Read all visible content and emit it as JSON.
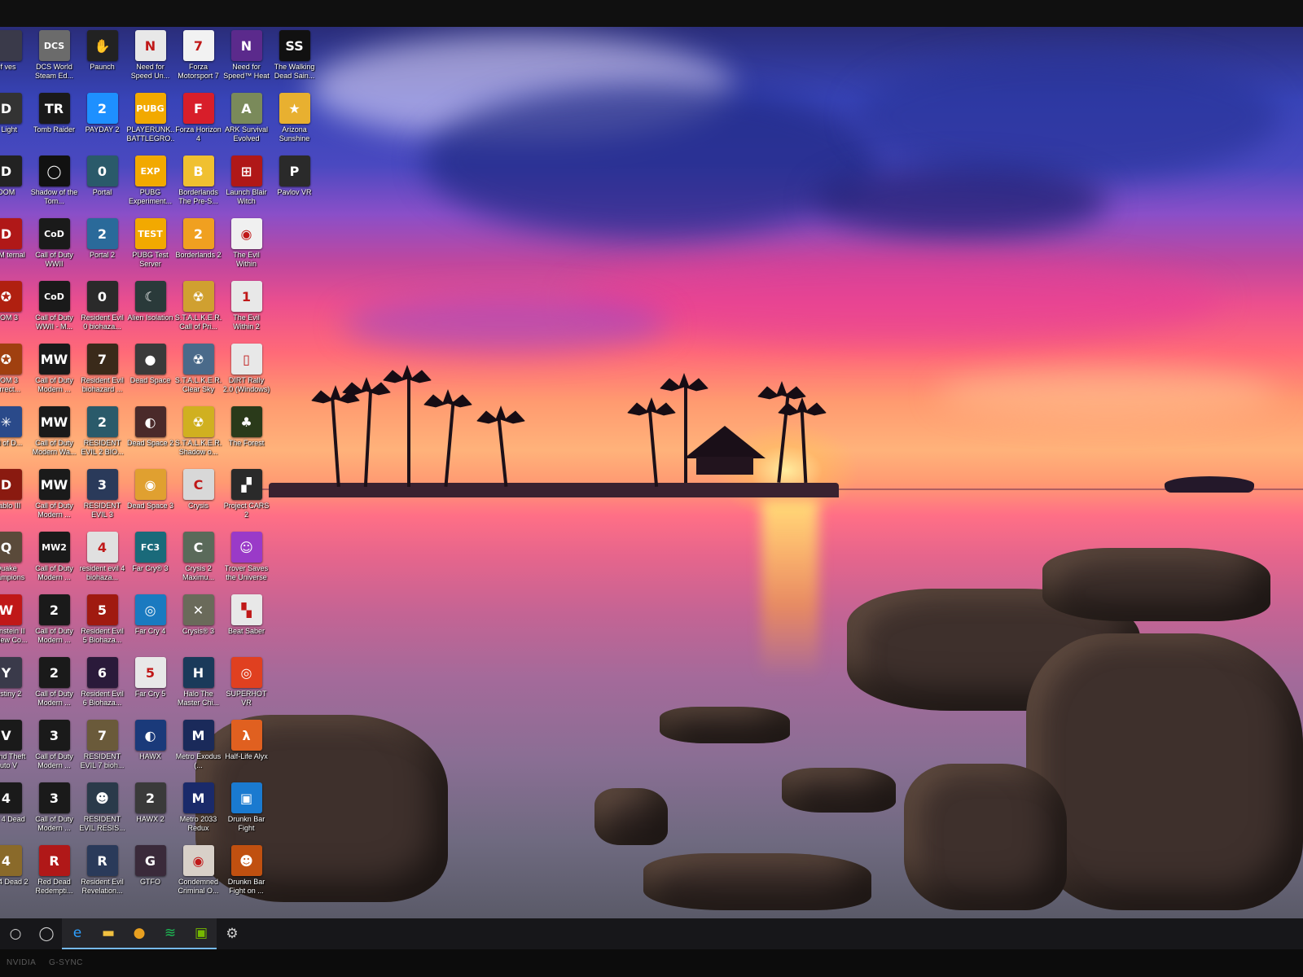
{
  "desktop": {
    "icons": [
      {
        "label": "of ves",
        "color": "#3a3a4a",
        "glyph": ""
      },
      {
        "label": "DCS World Steam Ed...",
        "color": "#6b6b6b",
        "glyph": "DCS"
      },
      {
        "label": "Paunch",
        "color": "#222222",
        "glyph": "✋"
      },
      {
        "label": "Need for Speed Un...",
        "color": "#e8e8e8",
        "glyph": "N"
      },
      {
        "label": "Forza Motorsport 7",
        "color": "#f2f2f2",
        "glyph": "7"
      },
      {
        "label": "Need for Speed™ Heat",
        "color": "#5b2a8c",
        "glyph": "N"
      },
      {
        "label": "The Walking Dead Sain...",
        "color": "#111111",
        "glyph": "SS"
      },
      {
        "label": "g Light",
        "color": "#333333",
        "glyph": "D"
      },
      {
        "label": "Tomb Raider",
        "color": "#1a1a1a",
        "glyph": "TR"
      },
      {
        "label": "PAYDAY 2",
        "color": "#1e90ff",
        "glyph": "2"
      },
      {
        "label": "PLAYERUNK... BATTLEGRO...",
        "color": "#f2a900",
        "glyph": "PUBG"
      },
      {
        "label": "Forza Horizon 4",
        "color": "#d81e2a",
        "glyph": "F"
      },
      {
        "label": "ARK Survival Evolved",
        "color": "#7a8a5a",
        "glyph": "A"
      },
      {
        "label": "Arizona Sunshine",
        "color": "#e8b030",
        "glyph": "★"
      },
      {
        "label": "OOM",
        "color": "#222222",
        "glyph": "D"
      },
      {
        "label": "Shadow of the Tom...",
        "color": "#111111",
        "glyph": "◯"
      },
      {
        "label": "Portal",
        "color": "#2a5a6a",
        "glyph": "0"
      },
      {
        "label": "PUBG Experiment...",
        "color": "#f2a900",
        "glyph": "EXP"
      },
      {
        "label": "Borderlands The Pre-S...",
        "color": "#f0c030",
        "glyph": "B"
      },
      {
        "label": "Launch Blair Witch",
        "color": "#b01818",
        "glyph": "⊞"
      },
      {
        "label": "Pavlov VR",
        "color": "#2a2a2a",
        "glyph": "P"
      },
      {
        "label": "OOM ternal",
        "color": "#b01818",
        "glyph": "D"
      },
      {
        "label": "Call of Duty WWII",
        "color": "#1a1a1a",
        "glyph": "CoD"
      },
      {
        "label": "Portal 2",
        "color": "#2a6a9a",
        "glyph": "2"
      },
      {
        "label": "PUBG Test Server",
        "color": "#f2a900",
        "glyph": "TEST"
      },
      {
        "label": "Borderlands 2",
        "color": "#f0a020",
        "glyph": "2"
      },
      {
        "label": "The Evil Within",
        "color": "#f0f0f0",
        "glyph": "◉"
      },
      {
        "label": "",
        "color": "transparent",
        "glyph": ""
      },
      {
        "label": "OOM 3",
        "color": "#b02010",
        "glyph": "✪"
      },
      {
        "label": "Call of Duty WWII - M...",
        "color": "#1a1a1a",
        "glyph": "CoD"
      },
      {
        "label": "Resident Evil 0 biohaza...",
        "color": "#2a2a2a",
        "glyph": "0"
      },
      {
        "label": "Alien Isolation",
        "color": "#2a3a3a",
        "glyph": "☾"
      },
      {
        "label": "S.T.A.L.K.E.R. Call of Pri...",
        "color": "#d0a030",
        "glyph": "☢"
      },
      {
        "label": "The Evil Within 2",
        "color": "#e8e8e8",
        "glyph": "1"
      },
      {
        "label": "",
        "color": "transparent",
        "glyph": ""
      },
      {
        "label": "OOM 3 surrect...",
        "color": "#a04010",
        "glyph": "✪"
      },
      {
        "label": "Call of Duty Modern ...",
        "color": "#1a1a1a",
        "glyph": "MW"
      },
      {
        "label": "Resident Evil biohazard ...",
        "color": "#3a2a1a",
        "glyph": "7"
      },
      {
        "label": "Dead Space",
        "color": "#3a3a3a",
        "glyph": "●"
      },
      {
        "label": "S.T.A.L.K.E.R. Clear Sky",
        "color": "#4a6a8a",
        "glyph": "☢"
      },
      {
        "label": "DIRT Rally 2.0 (Windows)",
        "color": "#e8e8e8",
        "glyph": "▯"
      },
      {
        "label": "",
        "color": "transparent",
        "glyph": ""
      },
      {
        "label": "ord of D...",
        "color": "#2a4a8a",
        "glyph": "✳"
      },
      {
        "label": "Call of Duty Modern Wa...",
        "color": "#1a1a1a",
        "glyph": "MW"
      },
      {
        "label": "RESIDENT EVIL 2 BIO...",
        "color": "#2a5a6a",
        "glyph": "2"
      },
      {
        "label": "Dead Space 2",
        "color": "#4a2a2a",
        "glyph": "◐"
      },
      {
        "label": "S.T.A.L.K.E.R. Shadow o...",
        "color": "#d0b020",
        "glyph": "☢"
      },
      {
        "label": "The Forest",
        "color": "#2a3a1a",
        "glyph": "♣"
      },
      {
        "label": "",
        "color": "transparent",
        "glyph": ""
      },
      {
        "label": "Diablo III",
        "color": "#8a1a10",
        "glyph": "D"
      },
      {
        "label": "Call of Duty Modern ...",
        "color": "#1a1a1a",
        "glyph": "MW"
      },
      {
        "label": "RESIDENT EVIL 3",
        "color": "#2a3a5a",
        "glyph": "3"
      },
      {
        "label": "Dead Space 3",
        "color": "#e0a030",
        "glyph": "◉"
      },
      {
        "label": "Crysis",
        "color": "#d8d8d8",
        "glyph": "C"
      },
      {
        "label": "Project CARS 2",
        "color": "#2a2a2a",
        "glyph": "▞"
      },
      {
        "label": "",
        "color": "transparent",
        "glyph": ""
      },
      {
        "label": "Quake Champions",
        "color": "#5a4a3a",
        "glyph": "Q"
      },
      {
        "label": "Call of Duty Modern ...",
        "color": "#1a1a1a",
        "glyph": "MW2"
      },
      {
        "label": "resident evil 4 biohaza...",
        "color": "#e0e0e0",
        "glyph": "4"
      },
      {
        "label": "Far Cry® 3",
        "color": "#1a6a7a",
        "glyph": "FC3"
      },
      {
        "label": "Crysis 2 Maximu...",
        "color": "#5a6a5a",
        "glyph": "C"
      },
      {
        "label": "Trover Saves the Universe",
        "color": "#9a3ac8",
        "glyph": "☺"
      },
      {
        "label": "",
        "color": "transparent",
        "glyph": ""
      },
      {
        "label": "olfenstein II he New Co...",
        "color": "#c01818",
        "glyph": "W"
      },
      {
        "label": "Call of Duty Modern ...",
        "color": "#1a1a1a",
        "glyph": "2"
      },
      {
        "label": "Resident Evil 5 Biohaza...",
        "color": "#a01a10",
        "glyph": "5"
      },
      {
        "label": "Far Cry 4",
        "color": "#1a7ac0",
        "glyph": "◎"
      },
      {
        "label": "Crysis® 3",
        "color": "#6a6a5a",
        "glyph": "✕"
      },
      {
        "label": "Beat Saber",
        "color": "#e8e8e8",
        "glyph": "▚"
      },
      {
        "label": "",
        "color": "transparent",
        "glyph": ""
      },
      {
        "label": "Destiny 2",
        "color": "#3a3a4a",
        "glyph": "Y"
      },
      {
        "label": "Call of Duty Modern ...",
        "color": "#1a1a1a",
        "glyph": "2"
      },
      {
        "label": "Resident Evil 6 Biohaza...",
        "color": "#2a1a3a",
        "glyph": "6"
      },
      {
        "label": "Far Cry 5",
        "color": "#e8e8e8",
        "glyph": "5"
      },
      {
        "label": "Halo The Master Chi...",
        "color": "#1a3a5a",
        "glyph": "H"
      },
      {
        "label": "SUPERHOT VR",
        "color": "#e04020",
        "glyph": "◎"
      },
      {
        "label": "",
        "color": "transparent",
        "glyph": ""
      },
      {
        "label": "Grand Theft Auto V",
        "color": "#1a1a1a",
        "glyph": "V"
      },
      {
        "label": "Call of Duty Modern ...",
        "color": "#1a1a1a",
        "glyph": "3"
      },
      {
        "label": "RESIDENT EVIL 7 bioh...",
        "color": "#6a5a3a",
        "glyph": "7"
      },
      {
        "label": "HAWX",
        "color": "#1a3a7a",
        "glyph": "◐"
      },
      {
        "label": "Metro Exodus (...",
        "color": "#1a2a5a",
        "glyph": "M"
      },
      {
        "label": "Half-Life Alyx",
        "color": "#e06020",
        "glyph": "λ"
      },
      {
        "label": "",
        "color": "transparent",
        "glyph": ""
      },
      {
        "label": "Left 4 Dead",
        "color": "#1a1a1a",
        "glyph": "4"
      },
      {
        "label": "Call of Duty Modern ...",
        "color": "#1a1a1a",
        "glyph": "3"
      },
      {
        "label": "RESIDENT EVIL RESIS...",
        "color": "#2a3a4a",
        "glyph": "☻"
      },
      {
        "label": "HAWX 2",
        "color": "#3a3a3a",
        "glyph": "2"
      },
      {
        "label": "Metro 2033 Redux",
        "color": "#1a2a6a",
        "glyph": "M"
      },
      {
        "label": "Drunkn Bar Fight",
        "color": "#1a7ad0",
        "glyph": "▣"
      },
      {
        "label": "",
        "color": "transparent",
        "glyph": ""
      },
      {
        "label": "Left 4 Dead 2",
        "color": "#8a6a2a",
        "glyph": "4"
      },
      {
        "label": "Red Dead Redempti...",
        "color": "#b01818",
        "glyph": "R"
      },
      {
        "label": "Resident Evil Revelation...",
        "color": "#2a3a5a",
        "glyph": "R"
      },
      {
        "label": "GTFO",
        "color": "#3a2a3a",
        "glyph": "G"
      },
      {
        "label": "Condemned Criminal O...",
        "color": "#d8d0c8",
        "glyph": "◉"
      },
      {
        "label": "Drunkn Bar Fight on ...",
        "color": "#c05010",
        "glyph": "☻"
      },
      {
        "label": "",
        "color": "transparent",
        "glyph": ""
      }
    ]
  },
  "taskbar": {
    "items": [
      {
        "name": "start",
        "glyph": "○"
      },
      {
        "name": "search",
        "glyph": "◯"
      },
      {
        "name": "edge",
        "glyph": "e"
      },
      {
        "name": "file-explorer",
        "glyph": "▬"
      },
      {
        "name": "chrome",
        "glyph": "●"
      },
      {
        "name": "spotify",
        "glyph": "≋"
      },
      {
        "name": "nvidia",
        "glyph": "▣"
      },
      {
        "name": "settings",
        "glyph": "⚙"
      }
    ]
  },
  "bezel": {
    "nvidia_label": "NVIDIA",
    "gsync_label": "G-SYNC"
  }
}
